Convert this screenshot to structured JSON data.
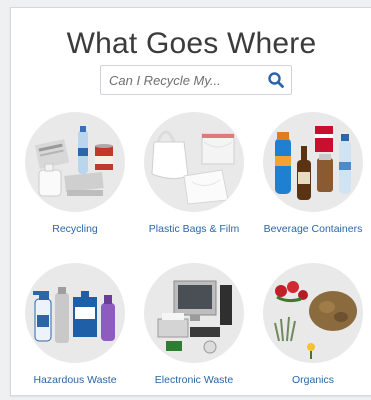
{
  "header": {
    "title": "What Goes Where"
  },
  "search": {
    "placeholder": "Can I Recycle My...",
    "icon": "search-icon"
  },
  "categories": [
    {
      "label": "Recycling",
      "icon": "recycling-items-image"
    },
    {
      "label": "Plastic Bags & Film",
      "icon": "plastic-bags-image"
    },
    {
      "label": "Beverage Containers",
      "icon": "beverage-containers-image"
    },
    {
      "label": "Hazardous Waste",
      "icon": "hazardous-waste-image"
    },
    {
      "label": "Electronic Waste",
      "icon": "electronic-waste-image"
    },
    {
      "label": "Organics",
      "icon": "organics-image"
    }
  ],
  "colors": {
    "title": "#3b3b3b",
    "link": "#2a66a8",
    "circle": "#e9e9e9",
    "search_icon": "#2a66a8"
  }
}
